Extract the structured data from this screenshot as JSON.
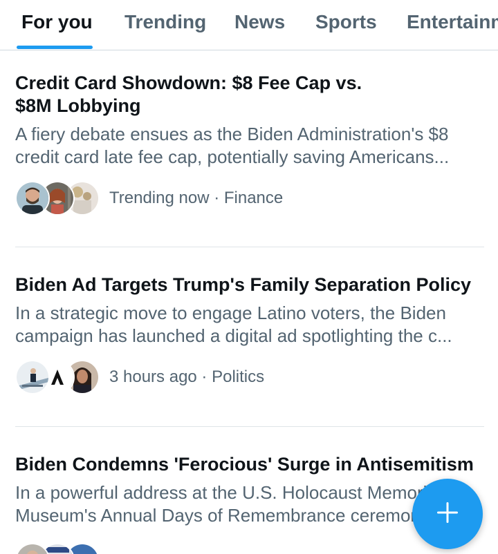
{
  "tabs": [
    {
      "label": "For you",
      "active": true
    },
    {
      "label": "Trending",
      "active": false
    },
    {
      "label": "News",
      "active": false
    },
    {
      "label": "Sports",
      "active": false
    },
    {
      "label": "Entertainment",
      "active": false
    }
  ],
  "stories": [
    {
      "title": "Credit Card Showdown: $8 Fee Cap vs. $8M Lobbying",
      "summary_line1": "A fiery debate ensues as the Biden Administration's $8",
      "summary_line2": "credit card late fee cap, potentially saving Americans...",
      "meta": "Trending now · Finance"
    },
    {
      "title": "Biden Ad Targets Trump's Family Separation Policy",
      "summary_line1": "In a strategic move to engage Latino voters, the Biden",
      "summary_line2": "campaign has launched a digital ad spotlighting the c...",
      "meta": "3 hours ago · Politics"
    },
    {
      "title": "Biden Condemns 'Ferocious' Surge in Antisemitism",
      "summary_line1": "In a powerful address at the U.S. Holocaust Memorial",
      "summary_line2": "Museum's Annual Days of Remembrance ceremony",
      "meta": ""
    }
  ],
  "fab": {
    "icon": "plus-icon",
    "color": "#1d9bf0"
  },
  "colors": {
    "accent": "#1d9bf0",
    "text_primary": "#0f1419",
    "text_secondary": "#536471"
  }
}
